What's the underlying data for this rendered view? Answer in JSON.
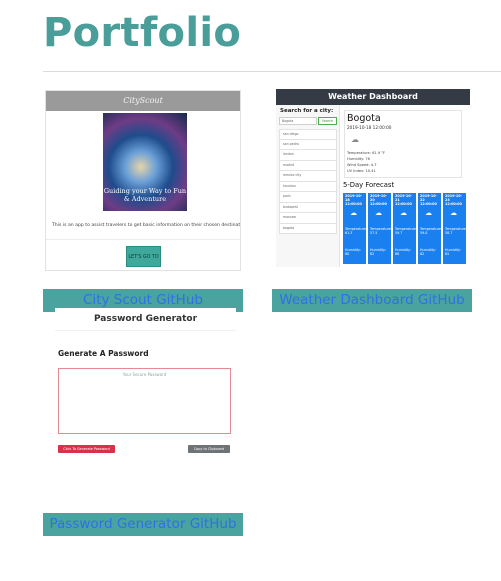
{
  "page": {
    "title": "Portfolio"
  },
  "projects": [
    {
      "link_label": "City Scout GitHub",
      "screenshot": {
        "header": "CityScout",
        "image_caption": "Guiding your Way to Fun & Adventure",
        "description": "This is an app to assist travelers to get basic information on their chosen destination.",
        "button_label": "LET'S GO TO IT"
      }
    },
    {
      "link_label": "Weather Dashboard GitHub",
      "screenshot": {
        "header": "Weather Dashboard",
        "search_label": "Search for a city:",
        "search_value": "Bogota",
        "search_button": "Search",
        "cities": [
          "san diego",
          "san pedro",
          "london",
          "madrid",
          "mexico city",
          "houston",
          "paris",
          "budapest",
          "moscow",
          "bogota"
        ],
        "current": {
          "city": "Bogota",
          "date": "2019-10-18 12:00:00",
          "temperature": "Temperature: 61.9 °F",
          "humidity": "Humidity: 76",
          "wind": "Wind Speed: 4.7",
          "uv": "UV Index: 10.41"
        },
        "forecast_title": "5-Day Forecast",
        "forecast": [
          {
            "date": "2019-10-18 12:00:00",
            "temp": "Temperature: 61.3",
            "humidity": "Humidity: 80"
          },
          {
            "date": "2019-10-20 12:00:00",
            "temp": "Temperature: 57.5",
            "humidity": "Humidity: 82"
          },
          {
            "date": "2019-10-21 12:00:00",
            "temp": "Temperature: 59.7",
            "humidity": "Humidity: 88"
          },
          {
            "date": "2019-10-22 12:00:00",
            "temp": "Temperature: 59.0",
            "humidity": "Humidity: 82"
          },
          {
            "date": "2019-10-23 12:00:00",
            "temp": "Temperature: 58.7",
            "humidity": "Humidity: 85"
          }
        ]
      }
    },
    {
      "link_label": "Password Generator GitHub",
      "screenshot": {
        "header": "Password Generator",
        "subheader": "Generate A Password",
        "placeholder": "Your Secure Password",
        "generate_button": "Click To Generate Password",
        "copy_button": "Copy to Clipboard"
      }
    }
  ],
  "colors": {
    "title": "#4a9e9a",
    "button_bg": "#4aa39e",
    "link_text": "#2f6fe8",
    "forecast_card": "#1a7fef"
  },
  "icons": {
    "forecast": "cloud-icon",
    "current": "weather-icon"
  }
}
